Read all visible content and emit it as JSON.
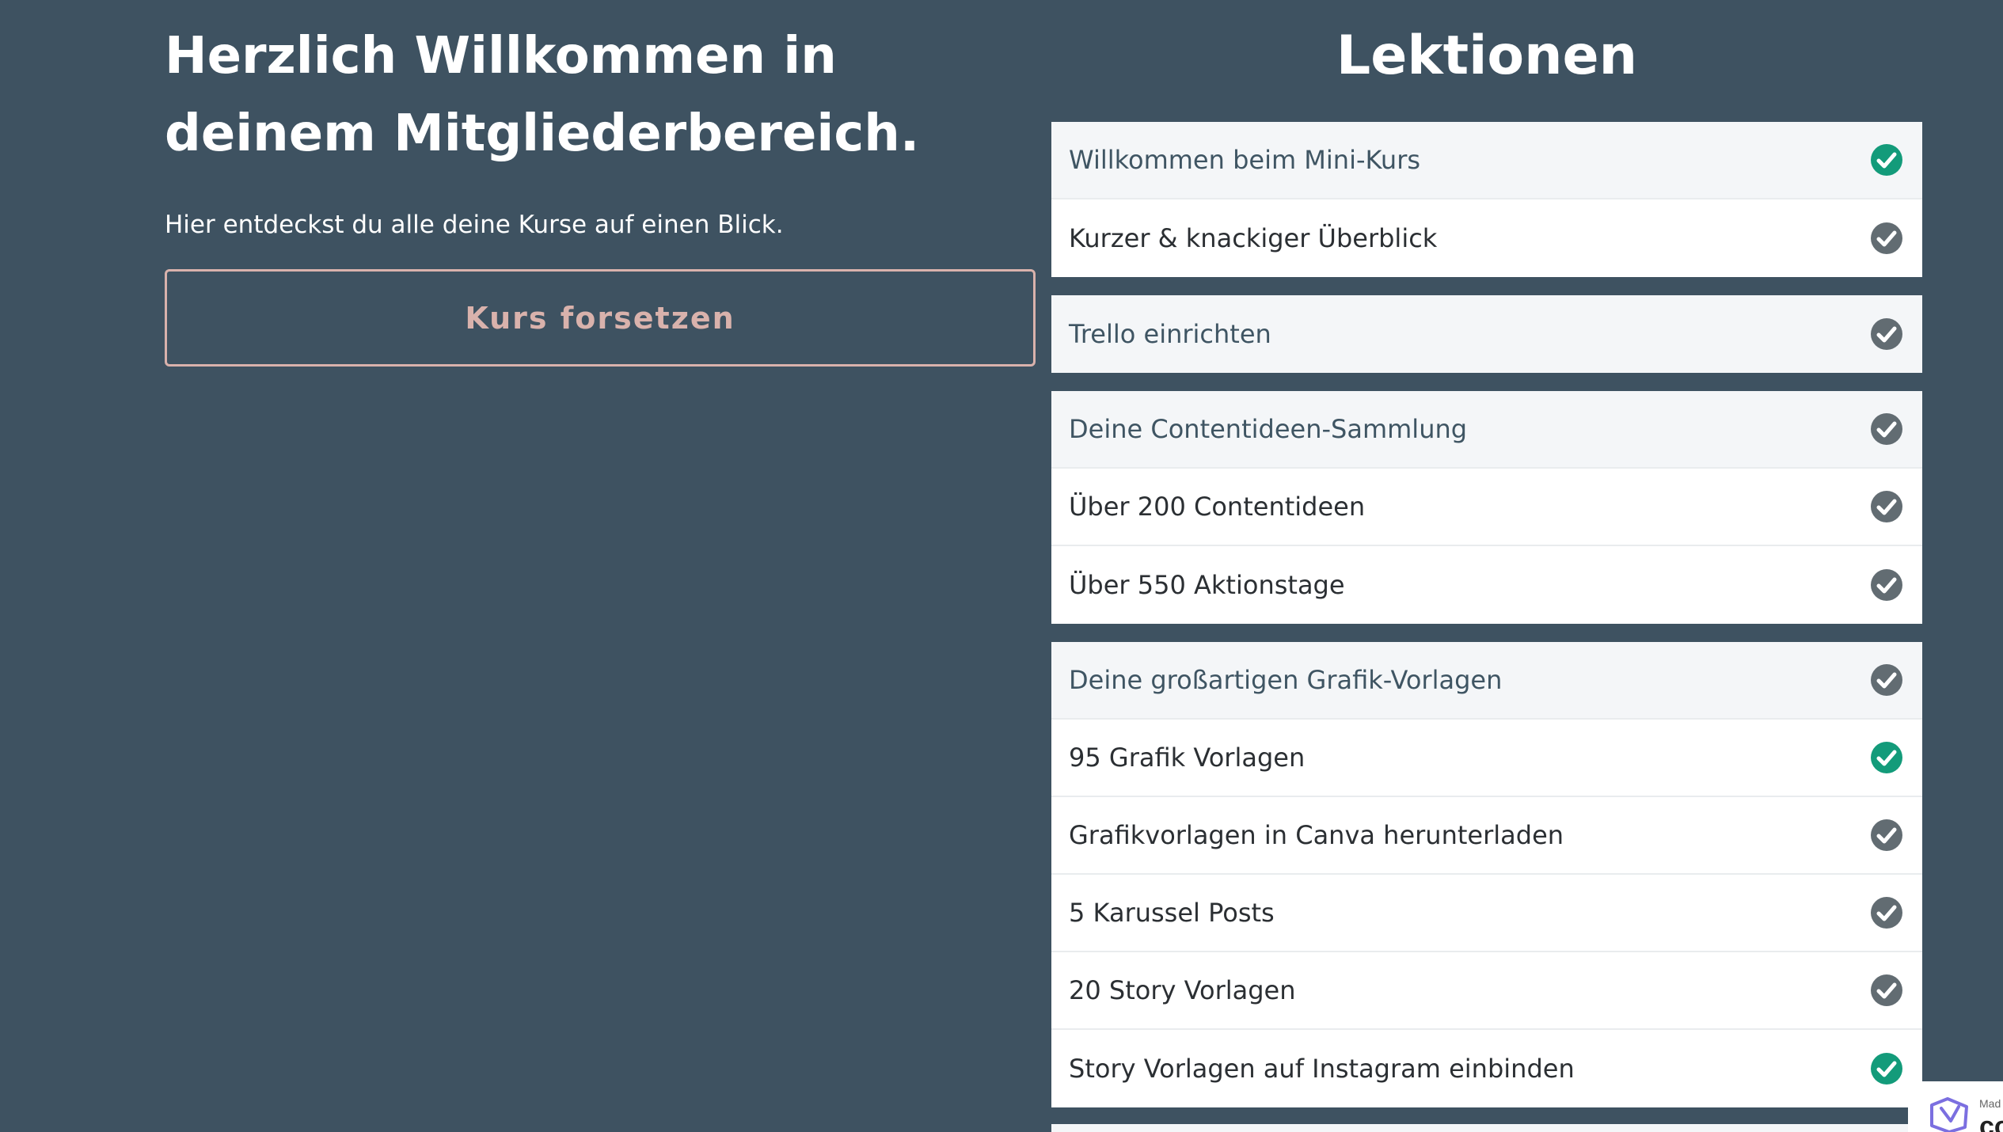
{
  "welcome": {
    "title": "Herzlich Willkommen in deinem Mitgliederbereich.",
    "subtitle": "Hier entdeckst du alle deine Kurse auf einen Blick.",
    "continue_button": "Kurs forsetzen"
  },
  "lessons": {
    "heading": "Lektionen",
    "sections": [
      {
        "rows": [
          {
            "label": "Willkommen beim Mini-Kurs",
            "type": "header",
            "status": "completed"
          },
          {
            "label": "Kurzer & knackiger Überblick",
            "type": "item",
            "status": "done"
          }
        ]
      },
      {
        "rows": [
          {
            "label": "Trello einrichten",
            "type": "header",
            "status": "done"
          }
        ]
      },
      {
        "rows": [
          {
            "label": "Deine Contentideen-Sammlung",
            "type": "header",
            "status": "done"
          },
          {
            "label": "Über 200 Contentideen",
            "type": "item",
            "status": "done"
          },
          {
            "label": "Über 550 Aktionstage",
            "type": "item",
            "status": "done"
          }
        ]
      },
      {
        "rows": [
          {
            "label": "Deine großartigen Grafik-Vorlagen",
            "type": "header",
            "status": "done"
          },
          {
            "label": "95 Grafik Vorlagen",
            "type": "item",
            "status": "completed"
          },
          {
            "label": "Grafikvorlagen in Canva herunterladen",
            "type": "item",
            "status": "done"
          },
          {
            "label": "5 Karussel Posts",
            "type": "item",
            "status": "done"
          },
          {
            "label": "20 Story Vorlagen",
            "type": "item",
            "status": "done"
          },
          {
            "label": "Story Vorlagen auf Instagram einbinden",
            "type": "item",
            "status": "completed"
          }
        ]
      }
    ]
  },
  "badge": {
    "small_text": "Mad",
    "big_text": "co",
    "icon": "brand-logo-icon"
  },
  "colors": {
    "background": "#3e5261",
    "accent": "#d9b2ac",
    "check_completed": "#139b7a",
    "check_done": "#626c72",
    "header_row_bg": "#f4f6f8",
    "item_row_bg": "#ffffff"
  }
}
